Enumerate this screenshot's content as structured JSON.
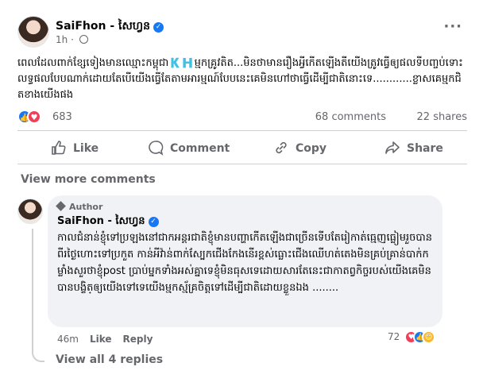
{
  "post": {
    "author": "SaiFhon - សៃហ្វន",
    "time": "1h",
    "text": "ពេលដែលពាក់ខ្សែទៀងមានឈ្មោះកម្ពុជា🇰🇭ម្មកគ្រូវតិត...មិនថាមានរឿងអ្វីកើតឡើងតីយើងត្រូវធ្វើឲ្យផលទីបញ្ចប់ទោះលទ្ធផលបែបណាក់ដោយតែបើយើងធ្វើតែតាមអារម្មណ៍បែបនេះគេមិនហៅថាធ្វើដើម្បីជាតិនោះទេ............ខ្លាសគេម្មកជិតខាងយើងផង",
    "reaction_count": "683",
    "comments_count": "68 comments",
    "shares_count": "22 shares"
  },
  "actions": {
    "like": "Like",
    "comment": "Comment",
    "copy": "Copy",
    "share": "Share"
  },
  "view_more_comments": "View more comments",
  "comment": {
    "badge": "Author",
    "author": "SaiFhon - សៃហ្វន",
    "text": "កាលជំនាន់ខ្ញុំទៅប្រឡងនៅជាកអន្តរជាតិខ្ញុំមានបញ្ហាកើតឡើងជាច្រើនទើបតែរៀកាត់ធ្មេញធ្លៀមរួចបានពីរថ្ងៃហោះទៅប្រកួត កាន់អីវ៉ាន់ពាក់ស្បែកជើងកែងនើរខ្ពស់ធ្លោះជើងឈើហត់តេងមិនគ្រប់គ្រាន់បាក់កម្លាំងសួរថាខ្ញុំpost ប្រាប់ម្នកទាំងអស់គ្នាទេខ្ញុំមិនធុសទេដោយសារតែនេះជាកាតព្វកិច្ចរបស់យើងគេមិនបានបង្ខិត្ឲ្យយើងទៅទេយើងម្មកស្ម័គ្រចិត្តទៅដើម្បីជាតិដោយខ្លួនឯង ........",
    "time": "46m",
    "like_label": "Like",
    "reply_label": "Reply",
    "reaction_count": "72",
    "view_replies": "View all 4 replies"
  }
}
